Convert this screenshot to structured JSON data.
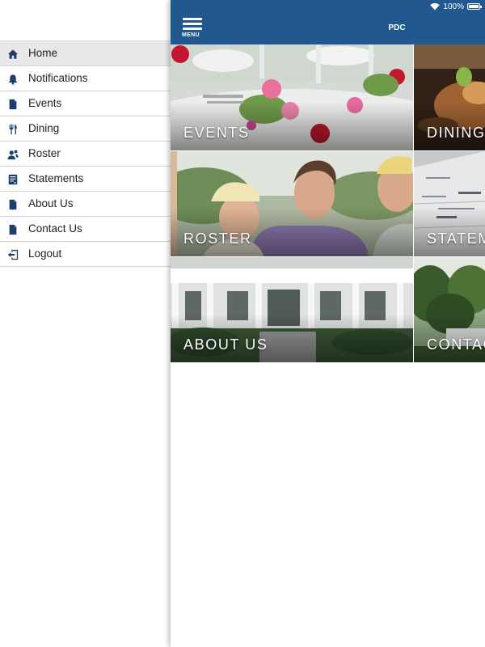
{
  "status_bar": {
    "battery": "100%"
  },
  "nav": {
    "menu_label": "MENU",
    "title": "PDC"
  },
  "sidebar": {
    "items": [
      {
        "label": "Home",
        "icon": "home-icon",
        "active": true
      },
      {
        "label": "Notifications",
        "icon": "bell-icon",
        "active": false
      },
      {
        "label": "Events",
        "icon": "document-icon",
        "active": false
      },
      {
        "label": "Dining",
        "icon": "fork-knife-icon",
        "active": false
      },
      {
        "label": "Roster",
        "icon": "people-icon",
        "active": false
      },
      {
        "label": "Statements",
        "icon": "statement-icon",
        "active": false
      },
      {
        "label": "About Us",
        "icon": "document-icon",
        "active": false
      },
      {
        "label": "Contact Us",
        "icon": "document-icon",
        "active": false
      },
      {
        "label": "Logout",
        "icon": "logout-icon",
        "active": false
      }
    ]
  },
  "tiles": {
    "events": {
      "label": "EVENTS"
    },
    "dining": {
      "label": "DINING"
    },
    "roster": {
      "label": "ROSTER"
    },
    "statements": {
      "label": "STATEMENTS"
    },
    "about": {
      "label": "ABOUT US"
    },
    "contact": {
      "label": "CONTACT US"
    }
  },
  "colors": {
    "brand_blue": "#21588f",
    "icon_navy": "#1d3d6e",
    "active_row": "#e8e8e8"
  }
}
